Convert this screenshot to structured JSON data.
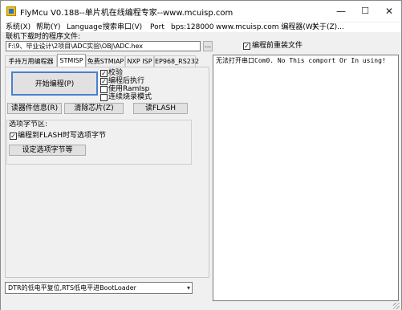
{
  "window": {
    "title": "FlyMcu V0.188--单片机在线编程专家--www.mcuisp.com",
    "minimize": "—",
    "maximize": "☐",
    "close": "✕"
  },
  "menu": {
    "items": [
      "系统(X)",
      "帮助(Y)",
      "Language",
      "搜索串口(V)",
      "Port",
      "bps:128000",
      "www.mcuisp.com 编程器(W)",
      "关于(Z)..."
    ]
  },
  "file": {
    "label": "联机下载时的程序文件:",
    "path": "F:\\9、毕业设计\\2项目\\ADC实验\\OBJ\\ADC.hex",
    "browse_label": "...",
    "reload_label": "编程前重装文件",
    "reload_checked": true
  },
  "tabs": [
    "手持万用编程器",
    "STMISP",
    "免费STMIAP",
    "NXP ISP",
    "EP968_RS232"
  ],
  "active_tab": 1,
  "stmisp": {
    "start_label": "开始编程(P)",
    "options": [
      {
        "label": "校验",
        "checked": true
      },
      {
        "label": "编程后执行",
        "checked": true
      },
      {
        "label": "使用RamIsp",
        "checked": false
      },
      {
        "label": "连续烧录模式",
        "checked": false
      }
    ],
    "read_info_label": "读器件信息(R)",
    "erase_label": "清除芯片(Z)",
    "read_flash_label": "读FLASH",
    "option_section_label": "选项字节区:",
    "write_option_label": "编程到FLASH时写选项字节",
    "write_option_checked": true,
    "set_option_label": "设定选项字节等"
  },
  "output": {
    "text": "无法打开串口Com0. No This comport Or In using!"
  },
  "reset_combo": {
    "value": "DTR的低电平复位,RTS低电平进BootLoader"
  }
}
